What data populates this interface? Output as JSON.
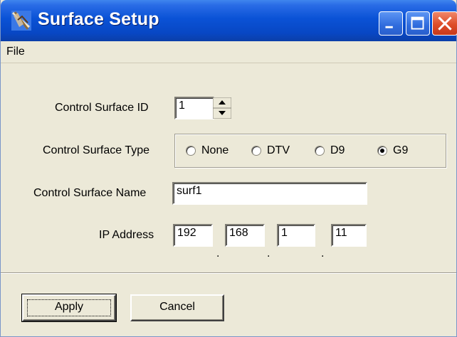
{
  "window": {
    "title": "Surface Setup",
    "icon": "surface-app-icon"
  },
  "titlebar_buttons": {
    "minimize_icon": "minimize-icon",
    "maximize_icon": "maximize-icon",
    "close_icon": "close-icon"
  },
  "menu": {
    "file": "File"
  },
  "form": {
    "id_label": "Control Surface ID",
    "id_value": "1",
    "type_label": "Control Surface Type",
    "type_options": [
      {
        "label": "None",
        "selected": false
      },
      {
        "label": "DTV",
        "selected": false
      },
      {
        "label": "D9",
        "selected": false
      },
      {
        "label": "G9",
        "selected": true
      }
    ],
    "name_label": "Control Surface Name",
    "name_value": "surf1",
    "ip_label": "IP Address",
    "ip_octets": [
      "192",
      "168",
      "1",
      "11"
    ],
    "ip_separator": "."
  },
  "buttons": {
    "apply": "Apply",
    "cancel": "Cancel"
  },
  "colors": {
    "titlebar": "#0a52d6",
    "face": "#ece9d8",
    "close": "#de4d28"
  }
}
